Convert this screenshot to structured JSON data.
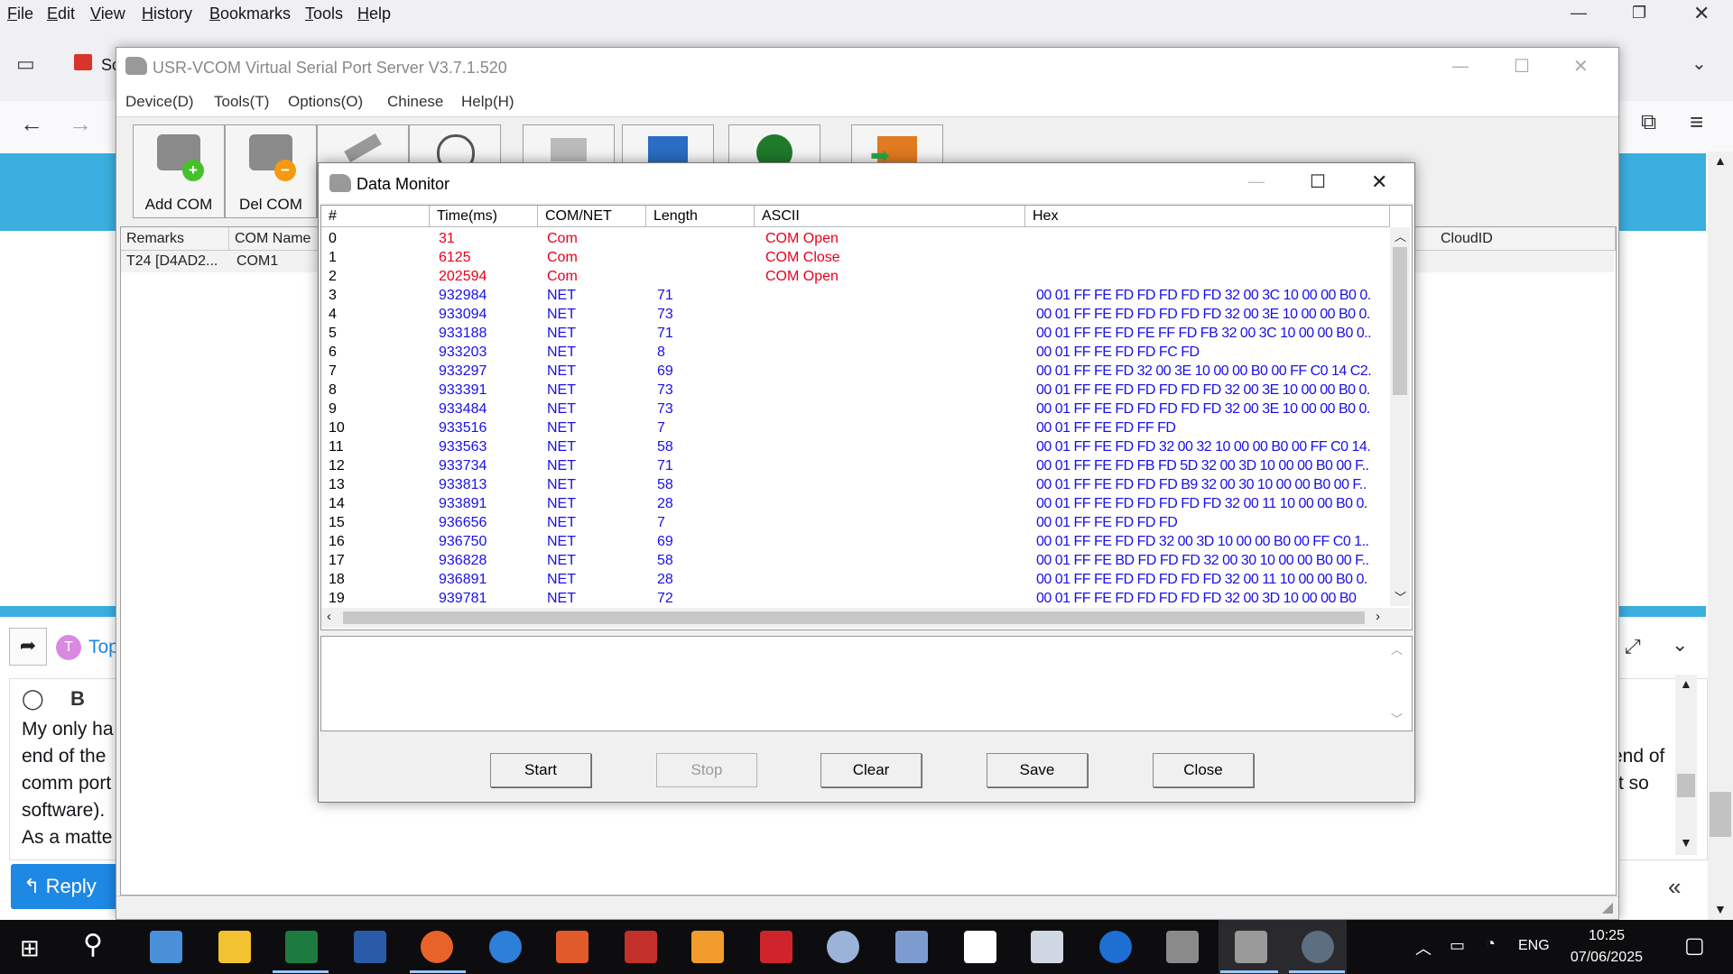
{
  "firefox": {
    "menu": [
      "File",
      "Edit",
      "View",
      "History",
      "Bookmarks",
      "Tools",
      "Help"
    ],
    "tab_label_partial": "Sc",
    "forum": {
      "topic_partial": "Top",
      "lines_left": [
        "My only ha",
        "end of the",
        "comm port",
        "software).",
        "As a matte"
      ],
      "lines_right": [
        "end of",
        "rt so"
      ],
      "reply_label": "Reply",
      "bold_label": "B",
      "avatar_letter": "T"
    }
  },
  "vcom": {
    "title": "USR-VCOM Virtual Serial Port Server V3.7.1.520",
    "menu": [
      "Device(D)",
      "Tools(T)",
      "Options(O)",
      "Chinese",
      "Help(H)"
    ],
    "toolbar": {
      "add_com": "Add COM",
      "del_com": "Del COM"
    },
    "list_headers": [
      "Remarks",
      "COM Name",
      "CloudID"
    ],
    "list_rows": [
      {
        "remarks": "T24 [D4AD2...",
        "com_name": "COM1"
      }
    ]
  },
  "monitor": {
    "title": "Data Monitor",
    "headers": [
      "#",
      "Time(ms)",
      "COM/NET",
      "Length",
      "ASCII",
      "Hex"
    ],
    "rows": [
      {
        "no": "0",
        "time": "31",
        "type": "Com",
        "len": "",
        "ascii": "COM Open",
        "hex": "",
        "color": "red"
      },
      {
        "no": "1",
        "time": "6125",
        "type": "Com",
        "len": "",
        "ascii": "COM Close",
        "hex": "",
        "color": "red"
      },
      {
        "no": "2",
        "time": "202594",
        "type": "Com",
        "len": "",
        "ascii": "COM Open",
        "hex": "",
        "color": "red"
      },
      {
        "no": "3",
        "time": "932984",
        "type": "NET",
        "len": "71",
        "ascii": "",
        "hex": "00 01 FF FE FD FD FD FD FD 32 00 3C 10 00 00 B0 0.",
        "color": "blue"
      },
      {
        "no": "4",
        "time": "933094",
        "type": "NET",
        "len": "73",
        "ascii": "",
        "hex": "00 01 FF FE FD FD FD FD FD 32 00 3E 10 00 00 B0 0.",
        "color": "blue"
      },
      {
        "no": "5",
        "time": "933188",
        "type": "NET",
        "len": "71",
        "ascii": "",
        "hex": "00 01 FF FE FD FE FF FD FB 32 00 3C 10 00 00 B0 0..",
        "color": "blue"
      },
      {
        "no": "6",
        "time": "933203",
        "type": "NET",
        "len": "8",
        "ascii": "",
        "hex": "00 01 FF FE FD FD FC FD",
        "color": "blue"
      },
      {
        "no": "7",
        "time": "933297",
        "type": "NET",
        "len": "69",
        "ascii": "",
        "hex": "00 01 FF FE FD 32 00 3E 10 00 00 B0 00 FF C0 14 C2.",
        "color": "blue"
      },
      {
        "no": "8",
        "time": "933391",
        "type": "NET",
        "len": "73",
        "ascii": "",
        "hex": "00 01 FF FE FD FD FD FD FD 32 00 3E 10 00 00 B0 0.",
        "color": "blue"
      },
      {
        "no": "9",
        "time": "933484",
        "type": "NET",
        "len": "73",
        "ascii": "",
        "hex": "00 01 FF FE FD FD FD FD FD 32 00 3E 10 00 00 B0 0.",
        "color": "blue"
      },
      {
        "no": "10",
        "time": "933516",
        "type": "NET",
        "len": "7",
        "ascii": "",
        "hex": "00 01 FF FE FD FF FD",
        "color": "blue"
      },
      {
        "no": "11",
        "time": "933563",
        "type": "NET",
        "len": "58",
        "ascii": "",
        "hex": "00 01 FF FE FD FD 32 00 32 10 00 00 B0 00 FF C0 14.",
        "color": "blue"
      },
      {
        "no": "12",
        "time": "933734",
        "type": "NET",
        "len": "71",
        "ascii": "",
        "hex": "00 01 FF FE FD FB FD 5D 32 00 3D 10 00 00 B0 00 F..",
        "color": "blue"
      },
      {
        "no": "13",
        "time": "933813",
        "type": "NET",
        "len": "58",
        "ascii": "",
        "hex": "00 01 FF FE FD FD FD B9 32 00 30 10 00 00 B0 00 F..",
        "color": "blue"
      },
      {
        "no": "14",
        "time": "933891",
        "type": "NET",
        "len": "28",
        "ascii": "",
        "hex": "00 01 FF FE FD FD FD FD FD 32 00 11 10 00 00 B0 0.",
        "color": "blue"
      },
      {
        "no": "15",
        "time": "936656",
        "type": "NET",
        "len": "7",
        "ascii": "",
        "hex": "00 01 FF FE FD FD FD",
        "color": "blue"
      },
      {
        "no": "16",
        "time": "936750",
        "type": "NET",
        "len": "69",
        "ascii": "",
        "hex": "00 01 FF FE FD FD 32 00 3D 10 00 00 B0 00 FF C0 1..",
        "color": "blue"
      },
      {
        "no": "17",
        "time": "936828",
        "type": "NET",
        "len": "58",
        "ascii": "",
        "hex": "00 01 FF FE BD FD FD FD 32 00 30 10 00 00 B0 00 F..",
        "color": "blue"
      },
      {
        "no": "18",
        "time": "936891",
        "type": "NET",
        "len": "28",
        "ascii": "",
        "hex": "00 01 FF FE FD FD FD FD FD 32 00 11 10 00 00 B0 0.",
        "color": "blue"
      },
      {
        "no": "19",
        "time": "939781",
        "type": "NET",
        "len": "72",
        "ascii": "",
        "hex": "00 01 FF FE FD FD FD FD FD 32 00 3D 10 00 00 B0",
        "color": "blue"
      }
    ],
    "buttons": {
      "start": "Start",
      "stop": "Stop",
      "clear": "Clear",
      "save": "Save",
      "close": "Close"
    }
  },
  "taskbar": {
    "language": "ENG",
    "time": "10:25",
    "date": "07/06/2025"
  },
  "colors": {
    "accent_blue": "#3aafe0",
    "log_red": "#e8001c",
    "log_blue": "#1a10e6",
    "reply_blue": "#1e88e5"
  }
}
